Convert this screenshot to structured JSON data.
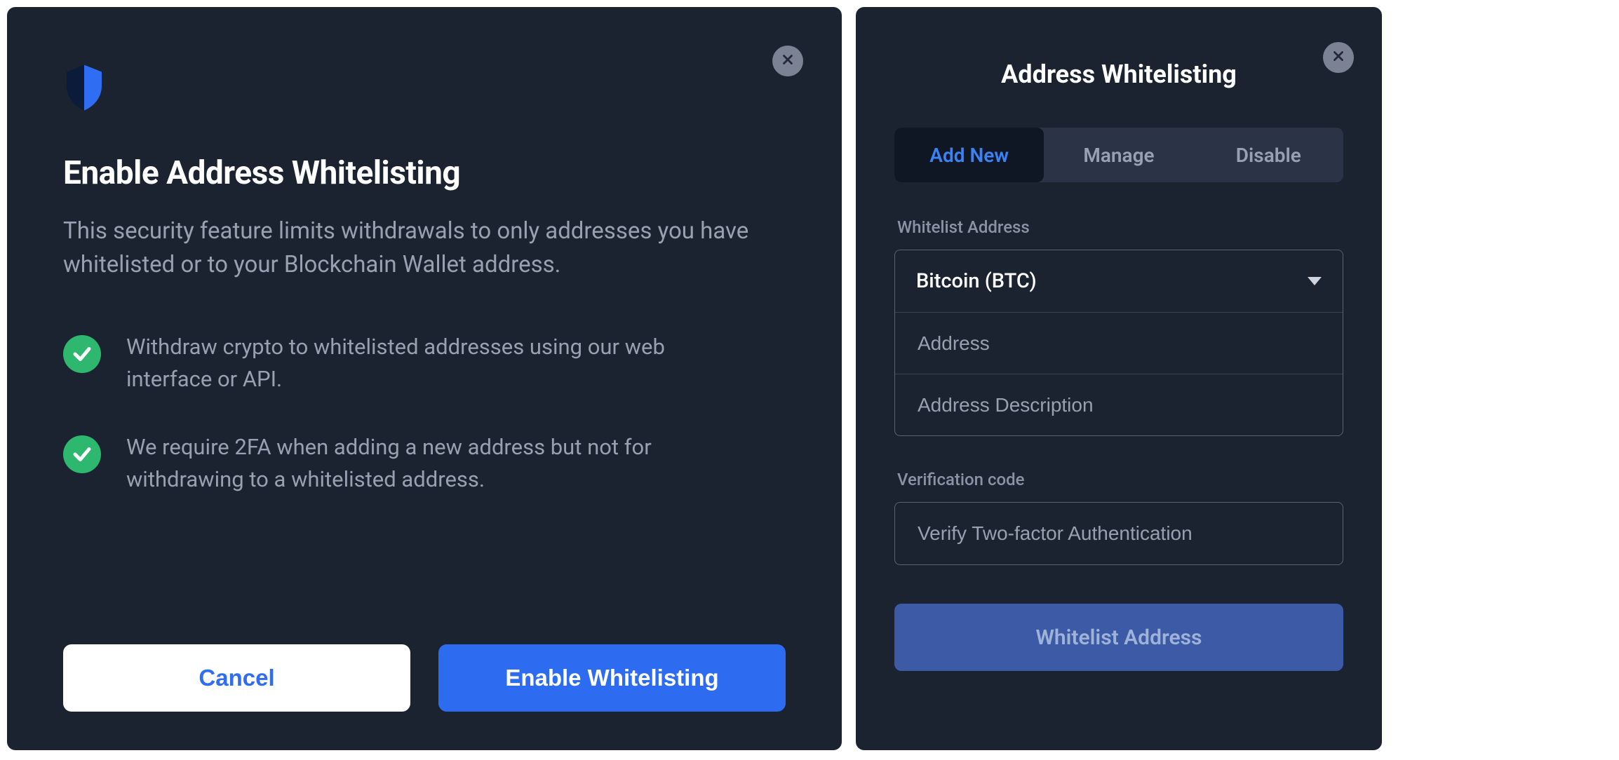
{
  "left_modal": {
    "title": "Enable Address Whitelisting",
    "subtitle": "This security feature limits withdrawals to only addresses you have whitelisted or to your Blockchain Wallet address.",
    "features": [
      "Withdraw crypto to whitelisted addresses using our web interface or API.",
      "We require 2FA when adding a new address but not for withdrawing to a whitelisted address."
    ],
    "cancel_label": "Cancel",
    "enable_label": "Enable Whitelisting"
  },
  "right_modal": {
    "title": "Address Whitelisting",
    "tabs": {
      "add_new": "Add New",
      "manage": "Manage",
      "disable": "Disable"
    },
    "section1_label": "Whitelist Address",
    "currency_selected": "Bitcoin (BTC)",
    "address_placeholder": "Address",
    "description_placeholder": "Address Description",
    "section2_label": "Verification code",
    "verification_placeholder": "Verify Two-factor Authentication",
    "submit_label": "Whitelist Address"
  }
}
